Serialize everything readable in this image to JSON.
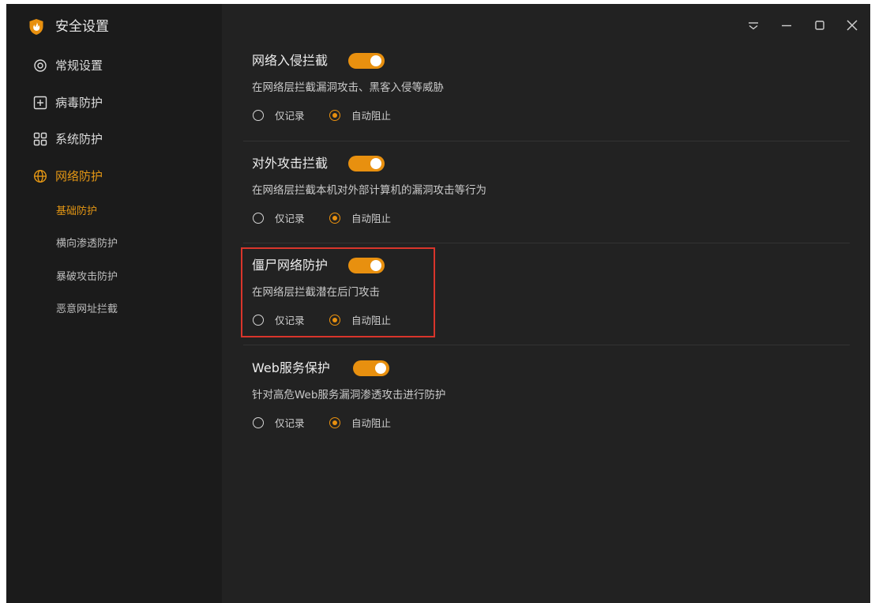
{
  "window": {
    "title": "安全设置",
    "controls": [
      "dropdown-icon",
      "minimize-icon",
      "maximize-icon",
      "close-icon"
    ]
  },
  "colors": {
    "accent": "#e8900f",
    "highlight_box": "#d9352b",
    "sidebar_bg": "#1b1b1b",
    "main_bg": "#222222"
  },
  "sidebar": {
    "items": [
      {
        "label": "常规设置",
        "icon": "gear-icon"
      },
      {
        "label": "病毒防护",
        "icon": "plus-square-icon"
      },
      {
        "label": "系统防护",
        "icon": "grid-icon"
      },
      {
        "label": "网络防护",
        "icon": "globe-icon",
        "active": true
      }
    ],
    "subitems": [
      {
        "label": "基础防护",
        "active": true
      },
      {
        "label": "横向渗透防护"
      },
      {
        "label": "暴破攻击防护"
      },
      {
        "label": "恶意网址拦截"
      }
    ]
  },
  "sections": [
    {
      "title": "网络入侵拦截",
      "enabled": true,
      "description": "在网络层拦截漏洞攻击、黑客入侵等威胁",
      "options": [
        "仅记录",
        "自动阻止"
      ],
      "selected": "自动阻止"
    },
    {
      "title": "对外攻击拦截",
      "enabled": true,
      "description": "在网络层拦截本机对外部计算机的漏洞攻击等行为",
      "options": [
        "仅记录",
        "自动阻止"
      ],
      "selected": "自动阻止"
    },
    {
      "title": "僵尸网络防护",
      "enabled": true,
      "description": "在网络层拦截潜在后门攻击",
      "options": [
        "仅记录",
        "自动阻止"
      ],
      "selected": "自动阻止",
      "highlighted": true
    },
    {
      "title": "Web服务保护",
      "enabled": true,
      "description": "针对高危Web服务漏洞渗透攻击进行防护",
      "options": [
        "仅记录",
        "自动阻止"
      ],
      "selected": "自动阻止"
    }
  ]
}
